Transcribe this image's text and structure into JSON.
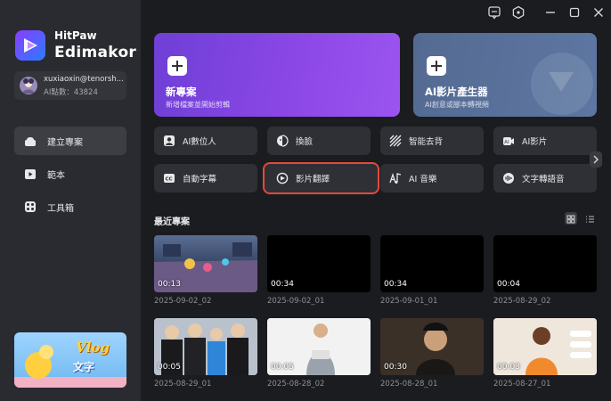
{
  "brand": {
    "top": "HitPaw",
    "main": "Edimakor"
  },
  "account": {
    "name": "xuxiaoxin@tenorsh...",
    "points": "AI點數：43824"
  },
  "nav": [
    {
      "label": "建立專案",
      "icon": "create-project-icon",
      "active": true
    },
    {
      "label": "範本",
      "icon": "template-icon",
      "active": false
    },
    {
      "label": "工具箱",
      "icon": "toolbox-icon",
      "active": false
    }
  ],
  "banner": {
    "title": "Vlog",
    "subtitle": "文字"
  },
  "cards": {
    "new_project": {
      "title": "新專案",
      "subtitle": "新增檔案並開始剪輯"
    },
    "ai_video": {
      "title": "AI影片產生器",
      "subtitle": "AI創意或腳本轉視頻"
    }
  },
  "tools": [
    {
      "label": "AI數位人",
      "icon": "ai-avatar-icon"
    },
    {
      "label": "換臉",
      "icon": "face-swap-icon"
    },
    {
      "label": "智能去背",
      "icon": "remove-background-icon"
    },
    {
      "label": "AI影片",
      "icon": "ai-video-icon"
    },
    {
      "label": "自動字幕",
      "icon": "auto-subtitle-icon"
    },
    {
      "label": "影片翻譯",
      "icon": "video-translate-icon",
      "selected": true
    },
    {
      "label": "AI 音樂",
      "icon": "ai-music-icon"
    },
    {
      "label": "文字轉語音",
      "icon": "text-to-speech-icon"
    }
  ],
  "recent": {
    "title": "最近專案",
    "items": [
      {
        "duration": "00:13",
        "date": "2025-09-02_02"
      },
      {
        "duration": "00:34",
        "date": "2025-09-02_01"
      },
      {
        "duration": "00:34",
        "date": "2025-09-01_01"
      },
      {
        "duration": "00:04",
        "date": "2025-08-29_02"
      },
      {
        "duration": "00:05",
        "date": "2025-08-29_01"
      },
      {
        "duration": "00:05",
        "date": "2025-08-28_02"
      },
      {
        "duration": "00:30",
        "date": "2025-08-28_01"
      },
      {
        "duration": "00:03",
        "date": "2025-08-27_01"
      }
    ]
  },
  "colors": {
    "accent_purple": "#8b47e6",
    "selection_outline": "#e5493a",
    "background": "#1b1c20",
    "sidebar": "#2a2b30"
  }
}
